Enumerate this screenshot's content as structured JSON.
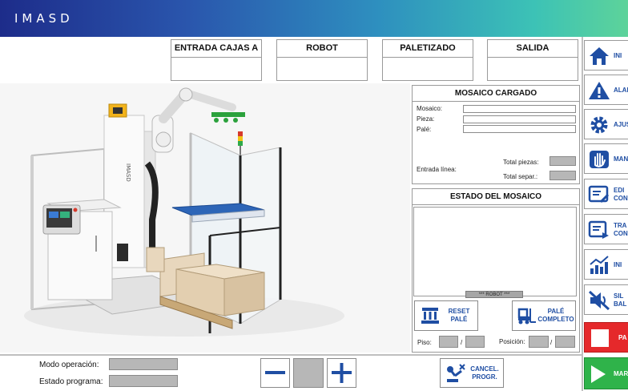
{
  "header": {
    "logo": "IMASD"
  },
  "status_boxes": [
    {
      "label": "ENTRADA CAJAS A",
      "value": ""
    },
    {
      "label": "ROBOT",
      "value": ""
    },
    {
      "label": "PALETIZADO",
      "value": ""
    },
    {
      "label": "SALIDA",
      "value": ""
    }
  ],
  "mosaico_cargado": {
    "title": "MOSAICO CARGADO",
    "mosaico_label": "Mosaico:",
    "pieza_label": "Pieza:",
    "pale_label": "Palé:",
    "total_piezas_label": "Total piezas:",
    "entrada_linea_label": "Entrada línea:",
    "total_separ_label": "Total separ.:"
  },
  "estado_mosaico": {
    "title": "ESTADO DEL MOSAICO",
    "robot_tag": "*** ROBOT ***",
    "reset_label_1": "RESET",
    "reset_label_2": "PALÉ",
    "completo_label_1": "PALÉ",
    "completo_label_2": "COMPLETO",
    "piso_label": "Piso:",
    "posicion_label": "Posición:",
    "sep": "/"
  },
  "sidebar": {
    "items": [
      {
        "label": "INI",
        "icon": "home-icon"
      },
      {
        "label": "ALAR",
        "icon": "alarm-icon"
      },
      {
        "label": "AJUS",
        "icon": "gear-icon"
      },
      {
        "label": "MAN",
        "icon": "hand-icon"
      },
      {
        "label_1": "EDI",
        "label_2": "CON",
        "icon": "edit-config-icon"
      },
      {
        "label_1": "TRA",
        "label_2": "CON",
        "icon": "transfer-config-icon"
      },
      {
        "label": "INI",
        "icon": "chart-icon"
      },
      {
        "label_1": "SIL",
        "label_2": "BAL",
        "icon": "mute-icon"
      }
    ],
    "stop_label": "PA",
    "run_label": "MAR"
  },
  "bottom": {
    "modo_label": "Modo operación:",
    "estado_label": "Estado programa:",
    "cancel_label_1": "CANCEL.",
    "cancel_label_2": "PROGR."
  },
  "colors": {
    "accent": "#1f4ea3",
    "stop": "#e5292b",
    "run": "#2fb34a"
  }
}
